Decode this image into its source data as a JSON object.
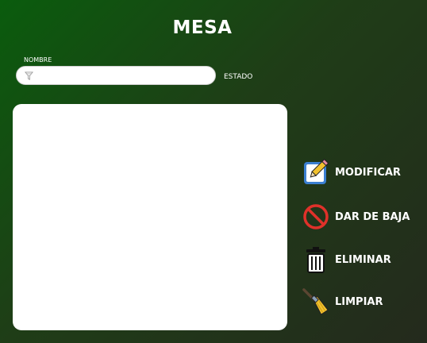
{
  "header": {
    "title": "MESA"
  },
  "form": {
    "name_label": "NOMBRE",
    "name_value": "",
    "estado_label": "ESTADO"
  },
  "actions": {
    "modify": "MODIFICAR",
    "deactivate": "DAR DE BAJA",
    "delete": "ELIMINAR",
    "clear": "LIMPIAR"
  },
  "icons": {
    "filter": "filter-icon",
    "modify": "edit-note-icon",
    "deactivate": "prohibited-icon",
    "delete": "trash-icon",
    "clear": "broom-icon"
  },
  "colors": {
    "gradient_start": "#0a5c0d",
    "gradient_end": "#242a1d",
    "prohibited_red": "#e0312a",
    "edit_blue": "#3b7fd1",
    "pencil_yellow": "#f2c12e"
  }
}
